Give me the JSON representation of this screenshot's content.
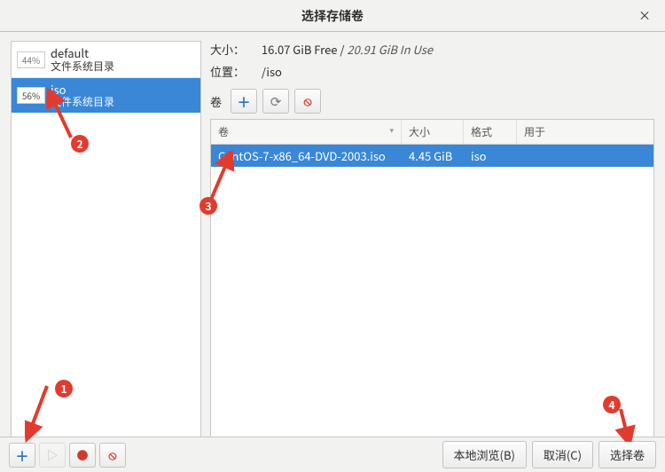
{
  "window": {
    "title": "选择存储卷",
    "close_glyph": "×"
  },
  "pools": [
    {
      "name": "default",
      "type": "文件系统目录",
      "pct": "44%"
    },
    {
      "name": "iso",
      "type": "文件系统目录",
      "pct": "56%"
    }
  ],
  "details": {
    "size_label": "大小：",
    "size_free": "16.07 GiB Free",
    "size_sep": " / ",
    "size_inuse": "20.91 GiB In Use",
    "loc_label": "位置：",
    "location": "/iso",
    "vol_label": "卷"
  },
  "icons": {
    "plus": "＋",
    "refresh": "⟳",
    "delete": "⦸",
    "play": "▷",
    "stop": "●"
  },
  "table": {
    "headers": {
      "name": "卷",
      "size": "大小",
      "format": "格式",
      "used": "用于"
    },
    "rows": [
      {
        "name": "CentOS-7-x86_64-DVD-2003.iso",
        "size": "4.45 GiB",
        "format": "iso",
        "used": ""
      }
    ]
  },
  "buttons": {
    "browse": "本地浏览(B)",
    "cancel": "取消(C)",
    "select": "选择卷"
  },
  "annotations": {
    "1": "1",
    "2": "2",
    "3": "3",
    "4": "4"
  }
}
